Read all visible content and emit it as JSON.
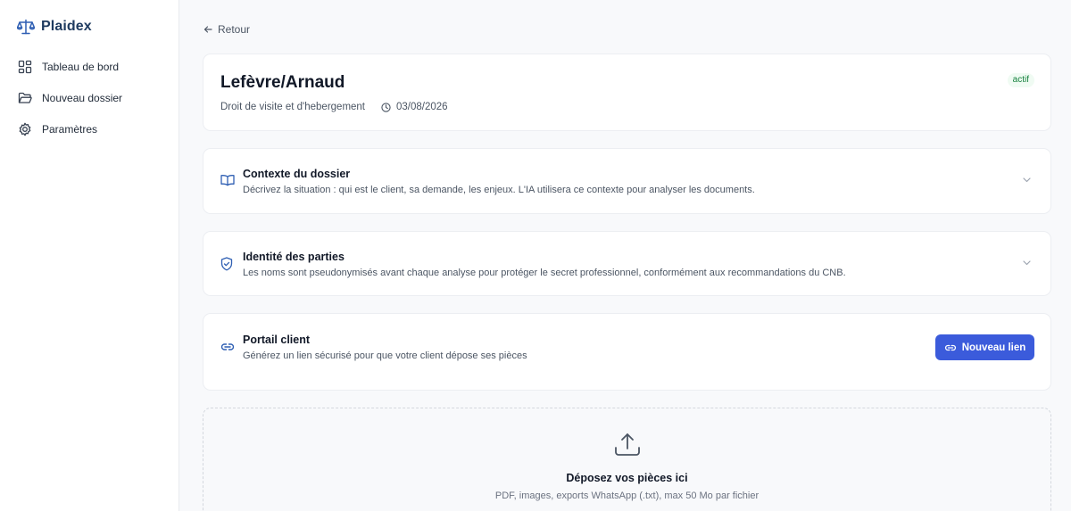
{
  "app": {
    "name": "Plaidex",
    "logo_icon": "balance-scale-icon"
  },
  "sidebar": {
    "items": [
      {
        "label": "Tableau de bord",
        "icon": "dashboard-grid-icon"
      },
      {
        "label": "Nouveau dossier",
        "icon": "folder-open-icon"
      },
      {
        "label": "Paramètres",
        "icon": "gear-icon"
      }
    ]
  },
  "back": {
    "label": "Retour",
    "icon": "arrow-left-icon"
  },
  "case": {
    "title": "Lefèvre/Arnaud",
    "type": "Droit de visite et d'hebergement",
    "date": "03/08/2026",
    "status": "actif"
  },
  "sections": {
    "context": {
      "title": "Contexte du dossier",
      "description": "Décrivez la situation : qui est le client, sa demande, les enjeux. L'IA utilisera ce contexte pour analyser les documents.",
      "icon": "book-open-icon"
    },
    "parties": {
      "title": "Identité des parties",
      "description": "Les noms sont pseudonymisés avant chaque analyse pour protéger le secret professionnel, conformément aux recommandations du CNB.",
      "icon": "shield-icon"
    },
    "portal": {
      "title": "Portail client",
      "description": "Générez un lien sécurisé pour que votre client dépose ses pièces",
      "icon": "link-icon",
      "button_label": "Nouveau lien"
    }
  },
  "upload": {
    "title": "Déposez vos pièces ici",
    "subtitle": "PDF, images, exports WhatsApp (.txt), max 50 Mo par fichier",
    "icon": "upload-icon"
  },
  "colors": {
    "accent": "#3b5bdb",
    "brand": "#1e3a5f",
    "status_bg": "#f0fbf3",
    "status_text": "#15803d"
  }
}
